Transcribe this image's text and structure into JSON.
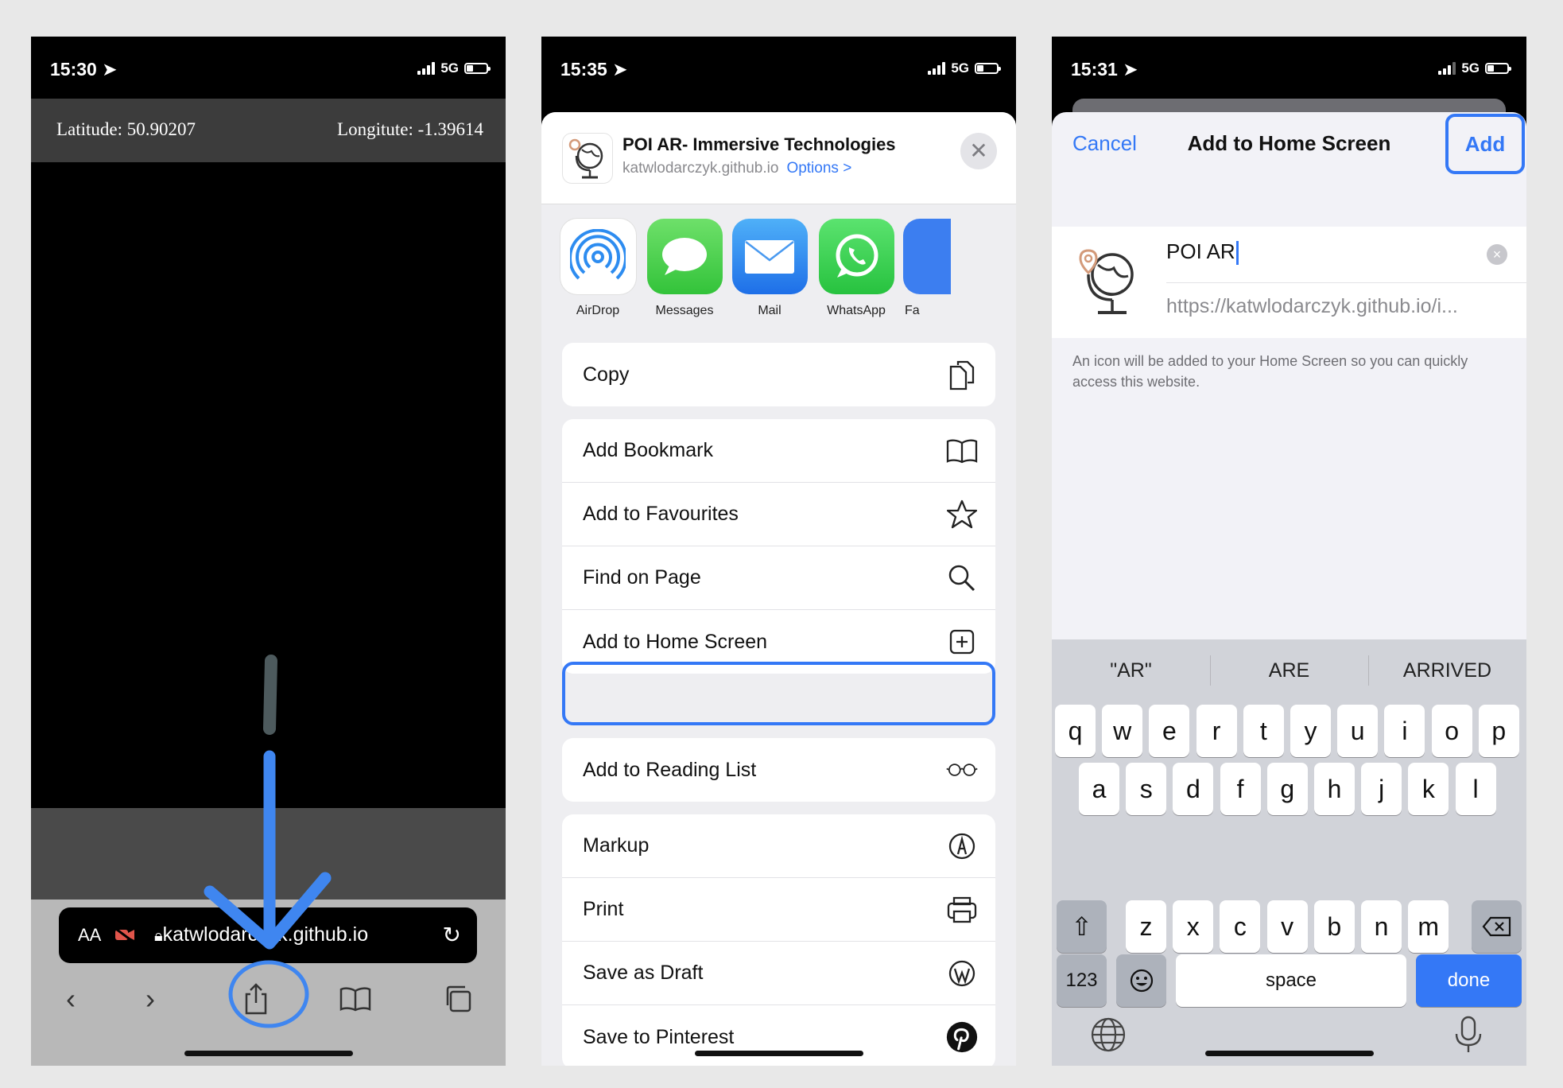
{
  "phone1": {
    "status": {
      "time": "15:30",
      "network": "5G"
    },
    "coords": {
      "latitude": "Latitude: 50.90207",
      "longitude": "Longitute: -1.39614"
    },
    "safari": {
      "text_size": "AA",
      "url": "katwlodarczyk.github.io"
    }
  },
  "phone2": {
    "status": {
      "time": "15:35",
      "network": "5G"
    },
    "header": {
      "title": "POI AR- Immersive Technologies",
      "domain": "katwlodarczyk.github.io",
      "options": "Options >",
      "close": "✕"
    },
    "apps": [
      {
        "label": "AirDrop"
      },
      {
        "label": "Messages"
      },
      {
        "label": "Mail"
      },
      {
        "label": "WhatsApp"
      },
      {
        "label": "Fa"
      }
    ],
    "actions": {
      "copy": "Copy",
      "add_bookmark": "Add Bookmark",
      "add_favourites": "Add to Favourites",
      "find_on_page": "Find on Page",
      "add_home_screen": "Add to Home Screen",
      "add_reading_list": "Add to Reading List",
      "markup": "Markup",
      "print": "Print",
      "save_draft": "Save as Draft",
      "save_pinterest": "Save to Pinterest"
    }
  },
  "phone3": {
    "status": {
      "time": "15:31",
      "network": "5G"
    },
    "nav": {
      "cancel": "Cancel",
      "title": "Add to Home Screen",
      "add": "Add"
    },
    "form": {
      "name": "POI AR",
      "url": "https://katwlodarczyk.github.io/i..."
    },
    "hint": "An icon will be added to your Home Screen so you can quickly access this website.",
    "keyboard": {
      "suggestions": [
        "\"AR\"",
        "ARE",
        "ARRIVED"
      ],
      "row1": [
        "q",
        "w",
        "e",
        "r",
        "t",
        "y",
        "u",
        "i",
        "o",
        "p"
      ],
      "row2": [
        "a",
        "s",
        "d",
        "f",
        "g",
        "h",
        "j",
        "k",
        "l"
      ],
      "row3": [
        "z",
        "x",
        "c",
        "v",
        "b",
        "n",
        "m"
      ],
      "numbers": "123",
      "space": "space",
      "done": "done"
    }
  },
  "colors": {
    "ios_blue": "#3478f6",
    "annotation_blue": "#3f86f0"
  }
}
